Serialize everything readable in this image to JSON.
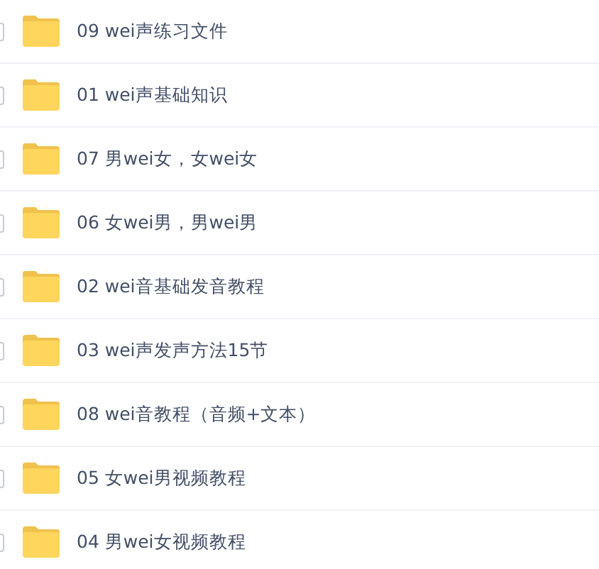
{
  "files": [
    {
      "name": "09 wei声练习文件",
      "checked": false
    },
    {
      "name": "01 wei声基础知识",
      "checked": false
    },
    {
      "name": "07 男wei女，女wei女",
      "checked": false
    },
    {
      "name": "06 女wei男，男wei男",
      "checked": false
    },
    {
      "name": "02 wei音基础发音教程",
      "checked": false
    },
    {
      "name": "03 wei声发声方法15节",
      "checked": false
    },
    {
      "name": "08 wei音教程（音频+文本）",
      "checked": false
    },
    {
      "name": "05 女wei男视频教程",
      "checked": false
    },
    {
      "name": "04 男wei女视频教程",
      "checked": false
    }
  ]
}
